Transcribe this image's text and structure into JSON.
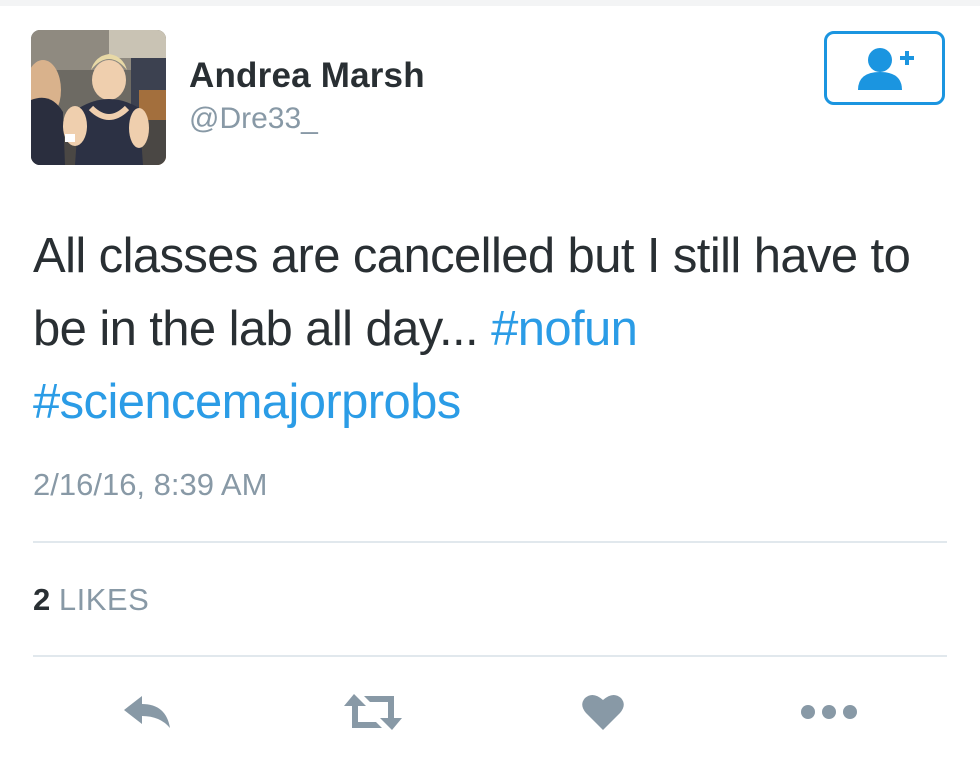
{
  "tweet": {
    "author": {
      "name": "Andrea Marsh",
      "handle": "@Dre33_"
    },
    "text_plain": "All classes are cancelled but I still have to be in the lab all day... ",
    "hashtags": [
      "#nofun",
      "#sciencemajorprobs"
    ],
    "timestamp": "2/16/16, 8:39 AM",
    "likes": {
      "count": "2",
      "label": "LIKES"
    }
  },
  "actions": {
    "follow_icon": "follow-user-icon",
    "reply_icon": "reply-icon",
    "retweet_icon": "retweet-icon",
    "like_icon": "heart-icon",
    "more_icon": "more-dots-icon"
  },
  "colors": {
    "accent": "#1b95e0",
    "hashtag": "#2b9ce6",
    "muted": "#8899a6",
    "icon": "#8899a6",
    "text": "#292f33",
    "divider": "#e1e8ed"
  }
}
